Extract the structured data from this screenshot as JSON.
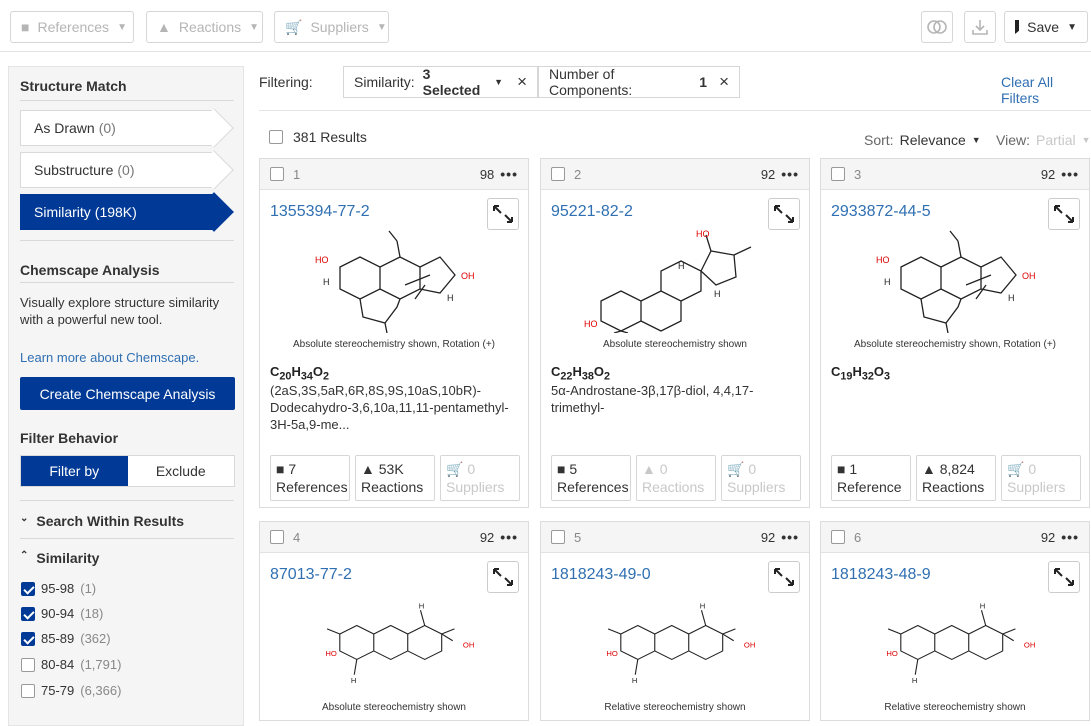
{
  "toolbar": {
    "references": "References",
    "reactions": "Reactions",
    "suppliers": "Suppliers",
    "save": "Save"
  },
  "sidebar": {
    "structure_match": "Structure Match",
    "as_drawn": {
      "label": "As Drawn",
      "count": "(0)"
    },
    "substructure": {
      "label": "Substructure",
      "count": "(0)"
    },
    "similarity": {
      "label": "Similarity",
      "count": "(198K)"
    },
    "chemscape_title": "Chemscape Analysis",
    "chemscape_desc": "Visually explore structure similarity with a powerful new tool.",
    "chemscape_link": "Learn more about Chemscape.",
    "create_chemscape": "Create Chemscape Analysis",
    "filter_behavior": "Filter Behavior",
    "filter_by": "Filter by",
    "exclude": "Exclude",
    "search_within": "Search Within Results",
    "similarity_section": "Similarity",
    "ranges": [
      {
        "label": "95-98",
        "count": "(1)",
        "checked": true
      },
      {
        "label": "90-94",
        "count": "(18)",
        "checked": true
      },
      {
        "label": "85-89",
        "count": "(362)",
        "checked": true
      },
      {
        "label": "80-84",
        "count": "(1,791)",
        "checked": false
      },
      {
        "label": "75-79",
        "count": "(6,366)",
        "checked": false
      }
    ]
  },
  "filters": {
    "label": "Filtering:",
    "similarity_prefix": "Similarity:",
    "similarity_value": "3 Selected",
    "components_prefix": "Number of Components:",
    "components_value": "1",
    "clear": "Clear All Filters"
  },
  "results": {
    "count": "381 Results",
    "sort_label": "Sort:",
    "sort_value": "Relevance",
    "view_label": "View:",
    "view_value": "Partial"
  },
  "cards": [
    {
      "index": "1",
      "score": "98",
      "cas": "1355394-77-2",
      "stereo": "Absolute stereochemistry shown, Rotation (+)",
      "formula": "C20H34O2",
      "name": "(2aS,3S,5aR,6R,8S,9S,10aS,10bR)-Dodecahydro-3,6,10a,11,11-pentamethyl-3H-5a,9-me...",
      "refs": "7",
      "refs_label": "References",
      "rxns": "53K",
      "rxns_label": "Reactions",
      "sups": "0",
      "sups_label": "Suppliers"
    },
    {
      "index": "2",
      "score": "92",
      "cas": "95221-82-2",
      "stereo": "Absolute stereochemistry shown",
      "formula": "C22H38O2",
      "name": "5α-Androstane-3β,17β-diol, 4,4,17-trimethyl-",
      "refs": "5",
      "refs_label": "References",
      "rxns": "0",
      "rxns_label": "Reactions",
      "sups": "0",
      "sups_label": "Suppliers"
    },
    {
      "index": "3",
      "score": "92",
      "cas": "2933872-44-5",
      "stereo": "Absolute stereochemistry shown, Rotation (+)",
      "formula": "C19H32O3",
      "name": "",
      "refs": "1",
      "refs_label": "Reference",
      "rxns": "8,824",
      "rxns_label": "Reactions",
      "sups": "0",
      "sups_label": "Suppliers"
    },
    {
      "index": "4",
      "score": "92",
      "cas": "87013-77-2",
      "stereo": "Absolute stereochemistry shown"
    },
    {
      "index": "5",
      "score": "92",
      "cas": "1818243-49-0",
      "stereo": "Relative stereochemistry shown"
    },
    {
      "index": "6",
      "score": "92",
      "cas": "1818243-48-9",
      "stereo": "Relative stereochemistry shown"
    }
  ],
  "colors": {
    "primary": "#003a96",
    "link": "#2f6fb2"
  }
}
